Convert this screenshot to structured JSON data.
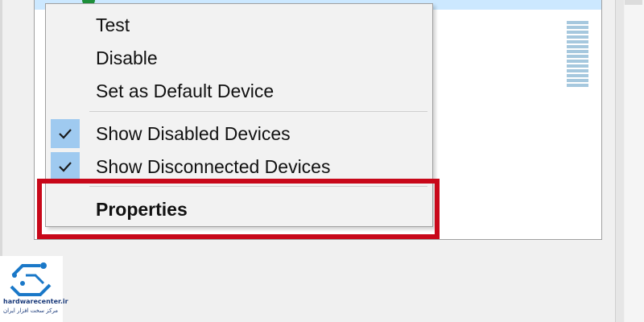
{
  "context_menu": {
    "items": [
      {
        "label": "Test",
        "checked": false
      },
      {
        "label": "Disable",
        "checked": false
      },
      {
        "label": "Set as Default Device",
        "checked": false
      },
      {
        "label": "Show Disabled Devices",
        "checked": true
      },
      {
        "label": "Show Disconnected Devices",
        "checked": true
      },
      {
        "label": "Properties",
        "checked": false,
        "emphasis": "bold"
      }
    ],
    "highlighted_item": "Properties"
  },
  "logo": {
    "domain": "hardwarecenter.ir",
    "tagline": "مرکز سخت افزار ایران",
    "icon": "circuit-logo-icon"
  },
  "colors": {
    "highlight_frame": "#c8081a",
    "check_background": "#9fcaf0",
    "menu_background": "#f2f2f2",
    "selection": "#cce8ff",
    "logo_blue": "#1a78c8"
  }
}
